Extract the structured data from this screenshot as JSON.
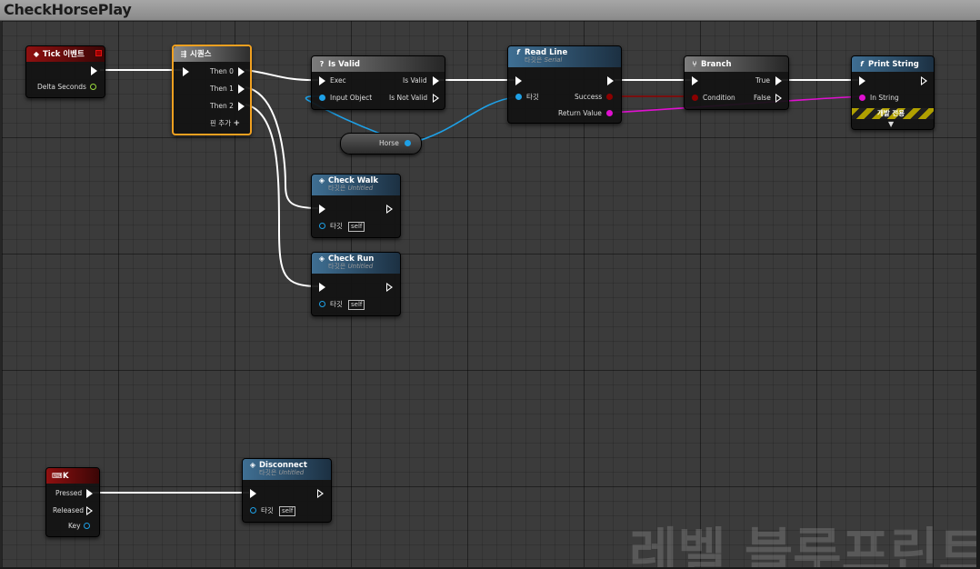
{
  "window": {
    "title": "CheckHorsePlay",
    "watermark": "레벨 블루프린트"
  },
  "nodes": {
    "tick": {
      "title": "Tick 이벤트",
      "delta_seconds": "Delta Seconds"
    },
    "sequence": {
      "title": "시퀀스",
      "then0": "Then 0",
      "then1": "Then 1",
      "then2": "Then 2",
      "add_pin": "핀 추가"
    },
    "is_valid": {
      "title": "Is Valid",
      "exec": "Exec",
      "input_object": "Input Object",
      "is_valid_out": "Is Valid",
      "is_not_valid": "Is Not Valid"
    },
    "read_line": {
      "title": "Read Line",
      "target_prefix": "타깃은",
      "target_name": "Serial",
      "target": "타깃",
      "success": "Success",
      "return_value": "Return Value"
    },
    "branch": {
      "title": "Branch",
      "condition": "Condition",
      "true_label": "True",
      "false_label": "False"
    },
    "print_string": {
      "title": "Print String",
      "in_string": "In String",
      "dev_only": "개발 전용"
    },
    "horse_var": {
      "label": "Horse"
    },
    "check_walk": {
      "title": "Check Walk",
      "target_prefix": "타깃은",
      "target_name": "Untitled",
      "target": "타깃",
      "self": "self"
    },
    "check_run": {
      "title": "Check Run",
      "target_prefix": "타깃은",
      "target_name": "Untitled",
      "target": "타깃",
      "self": "self"
    },
    "key_k": {
      "title": "K",
      "pressed": "Pressed",
      "released": "Released",
      "key": "Key"
    },
    "disconnect": {
      "title": "Disconnect",
      "target_prefix": "타깃은",
      "target_name": "Untitled",
      "target": "타깃",
      "self": "self"
    }
  },
  "colors": {
    "exec_wire": "#ffffff",
    "object_wire": "#1ea0e6",
    "bool_wire": "#8c0000",
    "string_wire": "#e010d0",
    "float_pin": "#9bdc3c",
    "selected_border": "#f0a020"
  }
}
